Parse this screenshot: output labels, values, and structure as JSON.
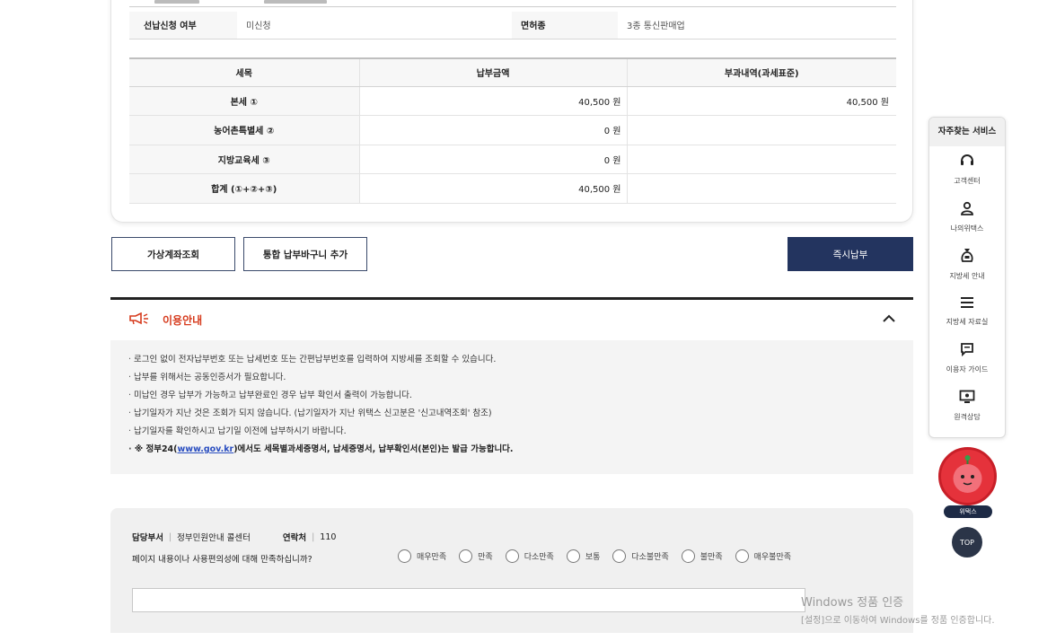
{
  "info": {
    "rows": [
      {
        "label1": "선납신청 여부",
        "value1": "미신청",
        "label2": "면허종",
        "value2": "3종 통신판매업"
      }
    ]
  },
  "tax_table": {
    "headers": [
      "세목",
      "납부금액",
      "부과내역(과세표준)"
    ],
    "rows": [
      {
        "item": "본세 ①",
        "amount": "40,500 원",
        "note": "40,500 원"
      },
      {
        "item": "농어촌특별세 ②",
        "amount": "0 원",
        "note": ""
      },
      {
        "item": "지방교육세 ③",
        "amount": "0 원",
        "note": ""
      },
      {
        "item": "합계 (①+②+③)",
        "amount": "40,500 원",
        "note": ""
      }
    ]
  },
  "buttons": {
    "virtual_account": "가상계좌조회",
    "add_basket": "통합 납부바구니 추가",
    "pay_now": "즉시납부"
  },
  "guide": {
    "title": "이용안내",
    "items": [
      "로그인 없이 전자납부번호 또는 납세번호 또는 간편납부번호를 입력하여 지방세를 조회할 수 있습니다.",
      "납부를 위해서는 공동인증서가 필요합니다.",
      "미납인 경우 납부가 가능하고 납부완료인 경우 납부 확인서 출력이 가능합니다.",
      "납기일자가 지난 것은 조회가 되지 않습니다. (납기일자가 지난 위택스 신고분은 '신고내역조회' 참조)",
      "납기일자를 확인하시고 납기일 이전에 납부하시기 바랍니다."
    ],
    "last_prefix": "※ 정부24(",
    "last_link": "www.gov.kr",
    "last_suffix": ")에서도 세목별과세증명서, 납세증명서, 납부확인서(본인)는 발급 가능합니다."
  },
  "survey": {
    "dept_label": "담당부서",
    "dept_value": "정부민원안내 콜센터",
    "contact_label": "연락처",
    "contact_value": "110",
    "question": "페이지 내용이나 사용편의성에 대해 만족하십니까?",
    "options": [
      "매우만족",
      "만족",
      "다소만족",
      "보통",
      "다소불만족",
      "불만족",
      "매우불만족"
    ]
  },
  "quick_menu": {
    "title": "자주찾는 서비스",
    "items": [
      {
        "label": "고객센터",
        "icon": "headset-icon"
      },
      {
        "label": "나의위택스",
        "icon": "person-icon"
      },
      {
        "label": "지방세 안내",
        "icon": "money-bag-icon"
      },
      {
        "label": "지방세 자료실",
        "icon": "list-icon"
      },
      {
        "label": "이용자 가이드",
        "icon": "chat-icon"
      },
      {
        "label": "원격상담",
        "icon": "monitor-icon"
      }
    ],
    "mascot_label": "위택스",
    "top_label": "TOP"
  },
  "watermark": {
    "line1": "Windows 정품 인증",
    "line2": "[설정]으로 이동하여 Windows를 정품 인증합니다."
  },
  "colors": {
    "primary": "#23345f",
    "accent": "#d63a1c",
    "link": "#2a4ec0"
  }
}
